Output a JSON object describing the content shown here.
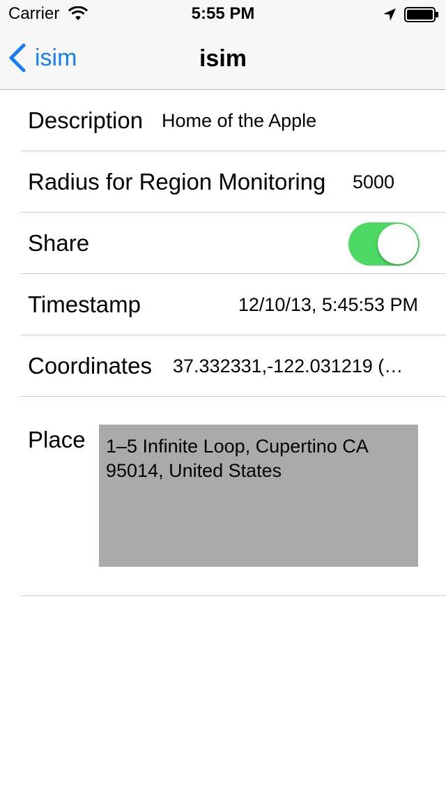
{
  "status_bar": {
    "carrier": "Carrier",
    "time": "5:55 PM",
    "icons": [
      "wifi-icon",
      "location-arrow-icon",
      "battery-icon"
    ]
  },
  "nav_bar": {
    "back_label": "isim",
    "title": "isim",
    "accent_color": "#157efb"
  },
  "rows": {
    "description": {
      "label": "Description",
      "value": "Home of the Apple"
    },
    "radius": {
      "label": "Radius for Region Monitoring",
      "value": "5000"
    },
    "share": {
      "label": "Share",
      "on": true,
      "on_color": "#4cd964"
    },
    "timestamp": {
      "label": "Timestamp",
      "value": "12/10/13, 5:45:53 PM"
    },
    "coordinates": {
      "label": "Coordinates",
      "value": "37.332331,-122.031219 (…"
    },
    "place": {
      "label": "Place",
      "value": "1–5 Infinite Loop, Cupertino CA 95014, United States"
    }
  }
}
